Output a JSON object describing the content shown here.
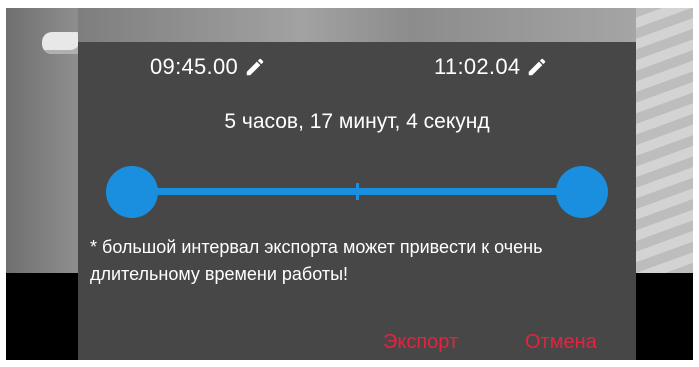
{
  "dialog": {
    "start_time": "09:45.00",
    "end_time": "11:02.04",
    "duration": "5 часов, 17 минут, 4 секунд",
    "warning": "* большой интервал экспорта может привести к очень длительному времени работы!",
    "export_label": "Экспорт",
    "cancel_label": "Отмена",
    "accent_color": "#1a8fe0",
    "action_color": "#e5223f",
    "range": {
      "start_fraction": 0.0,
      "end_fraction": 1.0
    }
  },
  "icons": {
    "edit": "pencil-icon"
  }
}
